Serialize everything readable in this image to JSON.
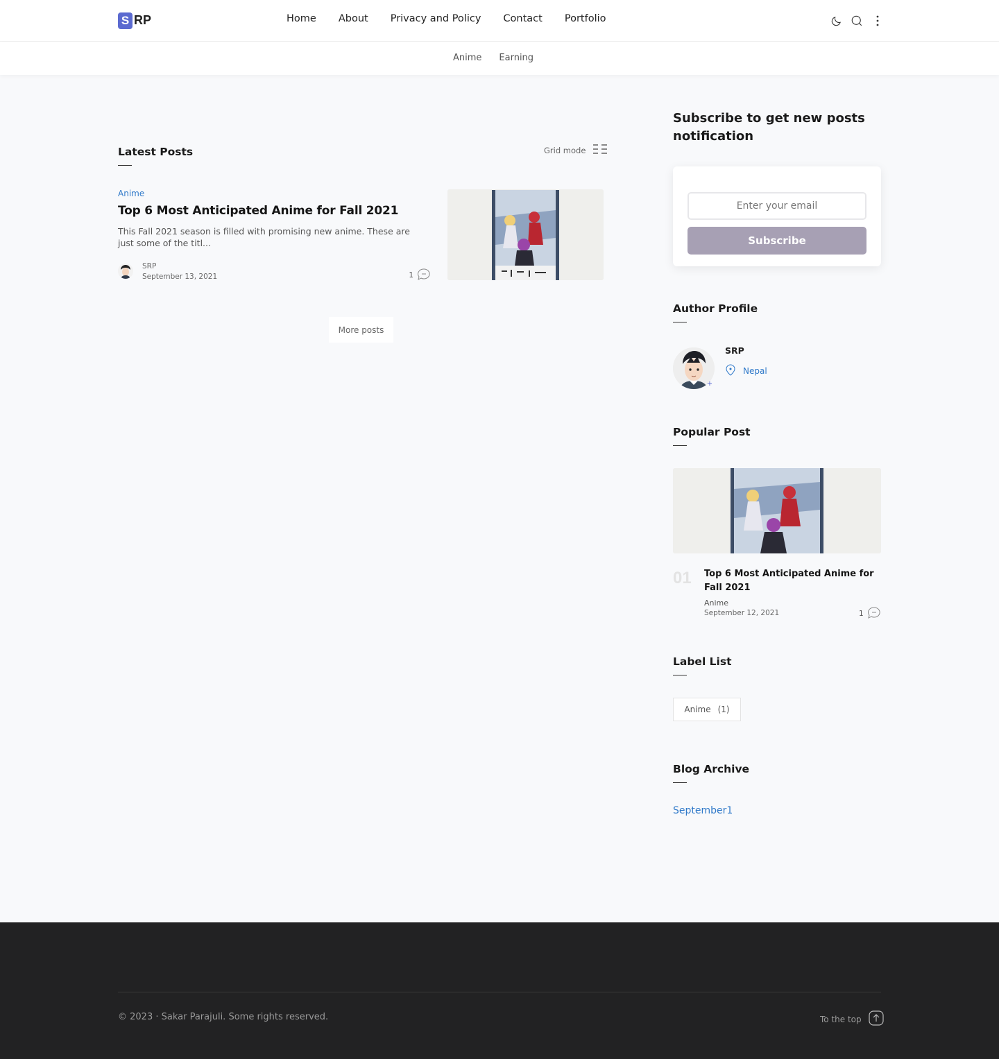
{
  "header": {
    "logo_mark": "S",
    "logo_text": "RP",
    "nav": [
      "Home",
      "About",
      "Privacy and Policy",
      "Contact",
      "Portfolio"
    ],
    "icons": [
      "moon-icon",
      "search-icon",
      "more-vertical-icon"
    ]
  },
  "subnav": [
    "Anime",
    "Earning"
  ],
  "main": {
    "latest_title": "Latest Posts",
    "grid_mode_label": "Grid mode",
    "post": {
      "label": "Anime",
      "title": "Top 6 Most Anticipated Anime for Fall 2021",
      "snippet": "This Fall 2021 season is filled with promising new anime. These are just some of the titl...",
      "author": "SRP",
      "date": "September 13, 2021",
      "comments": "1"
    },
    "more_posts": "More posts"
  },
  "sidebar": {
    "subscribe_heading": "Subscribe to get new posts notification",
    "email_placeholder": "Enter your email",
    "subscribe_button": "Subscribe",
    "author_title": "Author Profile",
    "author_name": "SRP",
    "author_location": "Nepal",
    "popular_title": "Popular Post",
    "popular": {
      "number": "01",
      "title": "Top 6 Most Anticipated Anime for Fall 2021",
      "label": "Anime",
      "date": "September 12, 2021",
      "comments": "1"
    },
    "label_title": "Label List",
    "label_chip": {
      "name": "Anime",
      "count": "(1)"
    },
    "archive_title": "Blog Archive",
    "archive_item": "September1"
  },
  "footer": {
    "copyright": "© 2023 · Sakar Parajuli. Some rights reserved.",
    "to_top": "To the top"
  },
  "colors": {
    "accent": "#5b6ad0",
    "link": "#2f79c9",
    "subscribe_button": "#a7a0b4",
    "footer_bg": "#222223"
  }
}
